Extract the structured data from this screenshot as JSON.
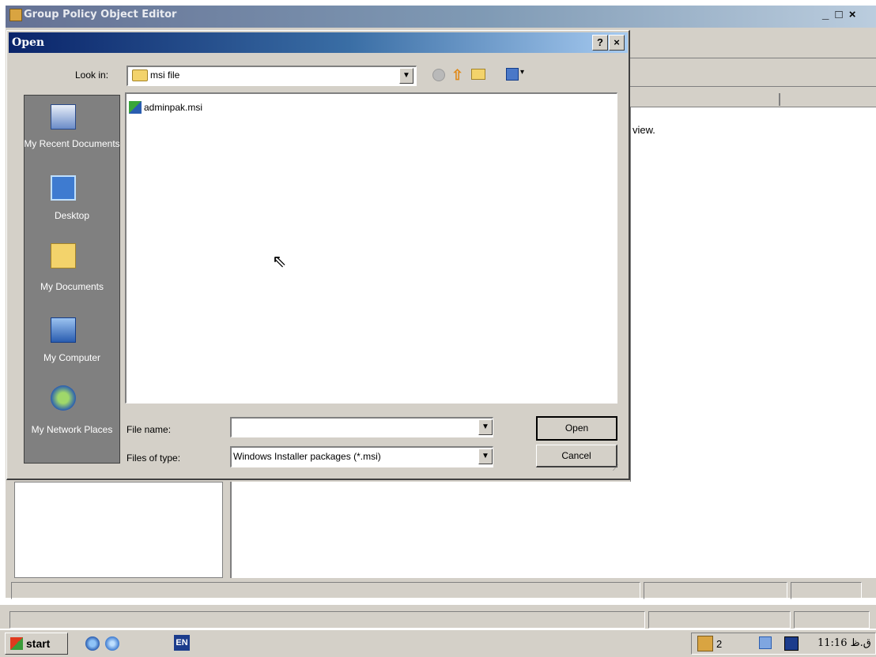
{
  "app_window": {
    "title": "Group Policy Object Editor",
    "window_controls": "_ □ ×",
    "description_fragment": "view."
  },
  "dialog": {
    "title": "Open",
    "help_label": "?",
    "close_label": "×",
    "look_in": {
      "label": "Look in:",
      "value": "msi file"
    },
    "places": [
      {
        "label": "My Recent Documents",
        "icon": "recent-documents-icon"
      },
      {
        "label": "Desktop",
        "icon": "desktop-icon"
      },
      {
        "label": "My Documents",
        "icon": "my-documents-icon"
      },
      {
        "label": "My Computer",
        "icon": "my-computer-icon"
      },
      {
        "label": "My Network Places",
        "icon": "network-places-icon"
      }
    ],
    "files": [
      {
        "name": "adminpak.msi",
        "icon": "msi-file-icon"
      }
    ],
    "file_name": {
      "label": "File name:",
      "value": ""
    },
    "files_of_type": {
      "label": "Files of type:",
      "value": "Windows Installer packages (*.msi)"
    },
    "open_label": "Open",
    "cancel_label": "Cancel"
  },
  "taskbar": {
    "start_label": "start",
    "language": "EN",
    "task_count": "2",
    "clock": "11:16 ق.ظ"
  }
}
